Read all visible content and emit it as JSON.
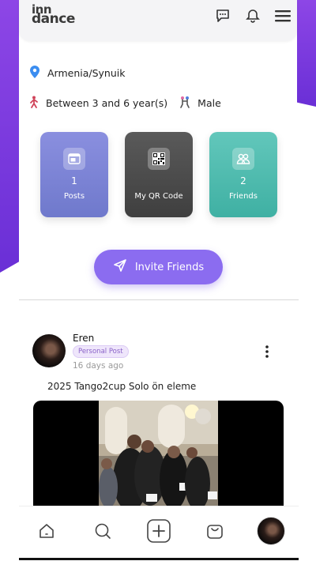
{
  "app": {
    "logo_line1": "inn",
    "logo_line2": "dance"
  },
  "header": {
    "icons": [
      "chat-icon",
      "bell-icon",
      "menu-icon"
    ]
  },
  "profile": {
    "location": "Armenia/Synuik",
    "experience": "Between 3 and 6 year(s)",
    "gender": "Male"
  },
  "stats": [
    {
      "num": "1",
      "label": "Posts",
      "color": "#7b84d8"
    },
    {
      "num": "",
      "label": "My QR Code",
      "color": "#4d4d4d"
    },
    {
      "num": "2",
      "label": "Friends",
      "color": "#4dbcb0"
    }
  ],
  "invite": {
    "label": "Invite Friends",
    "color": "#8b6cf0"
  },
  "post": {
    "author": "Eren",
    "badge": "Personal Post",
    "time": "16 days ago",
    "text": "2025 Tango2cup Solo ön eleme"
  },
  "nav": {
    "items": [
      "home-icon",
      "search-icon",
      "add-icon",
      "shop-icon",
      "profile-avatar"
    ]
  },
  "colors": {
    "accent": "#8b6cf0",
    "purple": "#7a3be0"
  }
}
